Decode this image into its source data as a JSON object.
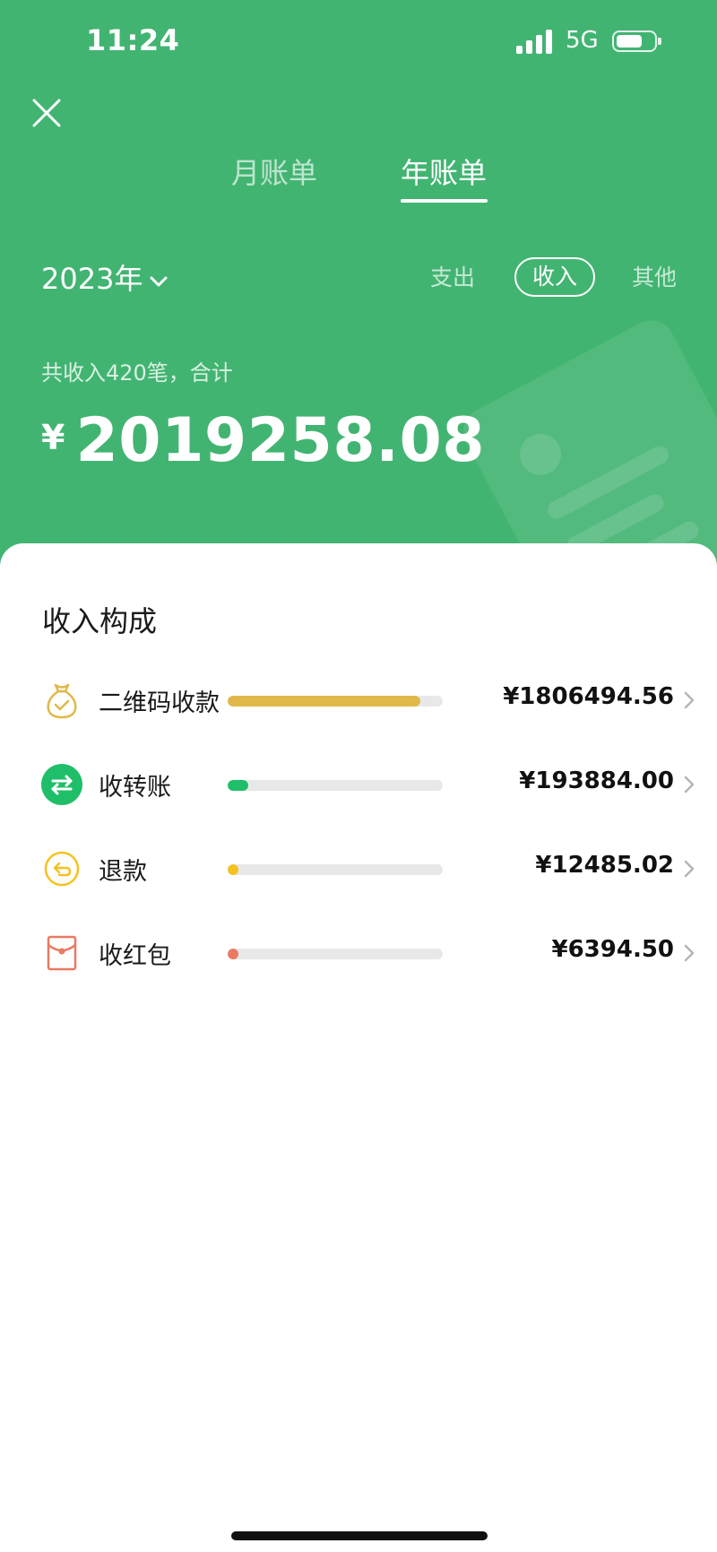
{
  "status_bar": {
    "time": "11:24",
    "network": "5G",
    "battery_level": 0.7
  },
  "nav": {
    "close_icon": "close-x-icon",
    "tabs": [
      {
        "label": "月账单",
        "active": false
      },
      {
        "label": "年账单",
        "active": true
      }
    ]
  },
  "filter": {
    "year_label": "2023年",
    "options": [
      {
        "label": "支出",
        "active": false
      },
      {
        "label": "收入",
        "active": true
      },
      {
        "label": "其他",
        "active": false
      }
    ]
  },
  "summary": {
    "text": "共收入420笔，合计",
    "currency": "¥",
    "total": "2019258.08"
  },
  "breakdown": {
    "title": "收入构成",
    "items": [
      {
        "label": "二维码收款",
        "amount": "¥1806494.56",
        "value": 1806494.56,
        "color": "#e0b84a",
        "icon": "money-bag-icon"
      },
      {
        "label": "收转账",
        "amount": "¥193884.00",
        "value": 193884.0,
        "color": "#1fbf6a",
        "icon": "transfer-icon"
      },
      {
        "label": "退款",
        "amount": "¥12485.02",
        "value": 12485.02,
        "color": "#f4c21f",
        "icon": "refund-icon"
      },
      {
        "label": "收红包",
        "amount": "¥6394.50",
        "value": 6394.5,
        "color": "#ea7a62",
        "icon": "red-packet-icon"
      }
    ]
  },
  "colors": {
    "header_green": "#42b472",
    "text_dark": "#1a1a1a"
  }
}
